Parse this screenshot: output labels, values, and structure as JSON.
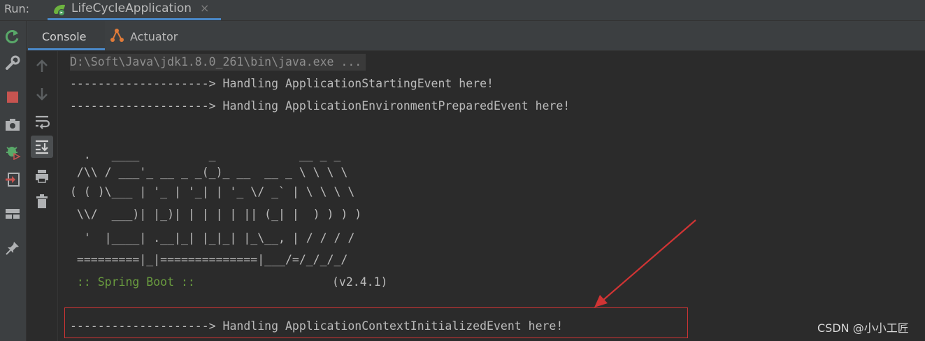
{
  "runbar": {
    "label": "Run:",
    "tab_title": "LifeCycleApplication",
    "close_glyph": "×"
  },
  "tabs": {
    "console": "Console",
    "actuator": "Actuator"
  },
  "left_toolbar_icons": [
    "rerun-icon",
    "wrench-icon",
    "stop-icon",
    "camera-icon",
    "debug-icon",
    "exit-icon",
    "layout-icon",
    "pin-icon"
  ],
  "console_toolbar_icons": [
    "up-arrow-icon",
    "down-arrow-icon",
    "soft-wrap-icon",
    "scroll-to-end-icon",
    "print-icon",
    "trash-icon"
  ],
  "console": {
    "cmd": "D:\\Soft\\Java\\jdk1.8.0_261\\bin\\java.exe ...",
    "line1": "--------------------> Handling ApplicationStartingEvent here!",
    "line2": "--------------------> Handling ApplicationEnvironmentPreparedEvent here!",
    "banner": [
      "  .   ____          _            __ _ _",
      " /\\\\ / ___'_ __ _ _(_)_ __  __ _ \\ \\ \\ \\",
      "( ( )\\___ | '_ | '_| | '_ \\/ _` | \\ \\ \\ \\",
      " \\\\/  ___)| |_)| | | | | || (_| |  ) ) ) )",
      "  '  |____| .__|_| |_|_| |_\\__, | / / / /",
      " =========|_|==============|___/=/_/_/_/"
    ],
    "spring_boot_label": " :: Spring Boot ::",
    "version": "(v2.4.1)",
    "line3": "--------------------> Handling ApplicationContextInitializedEvent here!"
  },
  "watermark": "CSDN @小小工匠",
  "colors": {
    "accent": "#4a88c7",
    "annotation_red": "#d03434",
    "spring_green": "#6a9d3f"
  }
}
